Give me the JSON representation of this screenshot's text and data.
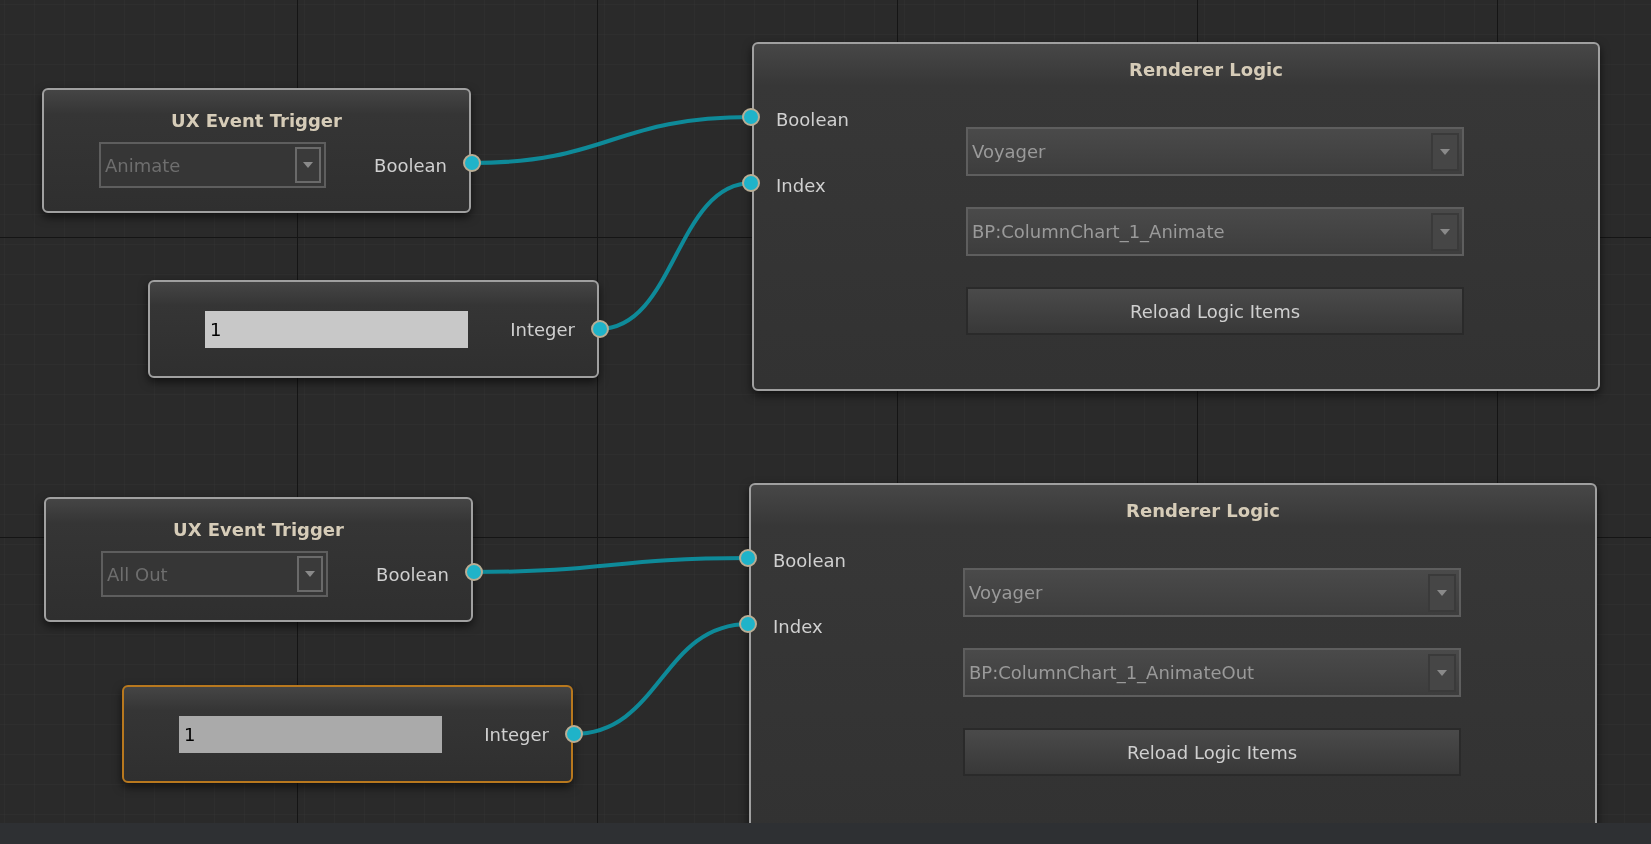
{
  "graphs": [
    {
      "trigger": {
        "title": "UX Event Trigger",
        "dropdown": {
          "value": "Animate",
          "disabled": true
        },
        "port": "Boolean"
      },
      "integer": {
        "value": "1",
        "port": "Integer",
        "selected": false
      },
      "renderer": {
        "title": "Renderer Logic",
        "inputs": [
          "Boolean",
          "Index"
        ],
        "dropdowns": [
          {
            "value": "Voyager"
          },
          {
            "value": "BP:ColumnChart_1_Animate"
          }
        ],
        "button": "Reload Logic Items"
      }
    },
    {
      "trigger": {
        "title": "UX Event Trigger",
        "dropdown": {
          "value": "All Out",
          "disabled": true
        },
        "port": "Boolean"
      },
      "integer": {
        "value": "1",
        "port": "Integer",
        "selected": true
      },
      "renderer": {
        "title": "Renderer Logic",
        "inputs": [
          "Boolean",
          "Index"
        ],
        "dropdowns": [
          {
            "value": "Voyager"
          },
          {
            "value": "BP:ColumnChart_1_AnimateOut"
          }
        ],
        "button": "Reload Logic Items"
      }
    }
  ]
}
